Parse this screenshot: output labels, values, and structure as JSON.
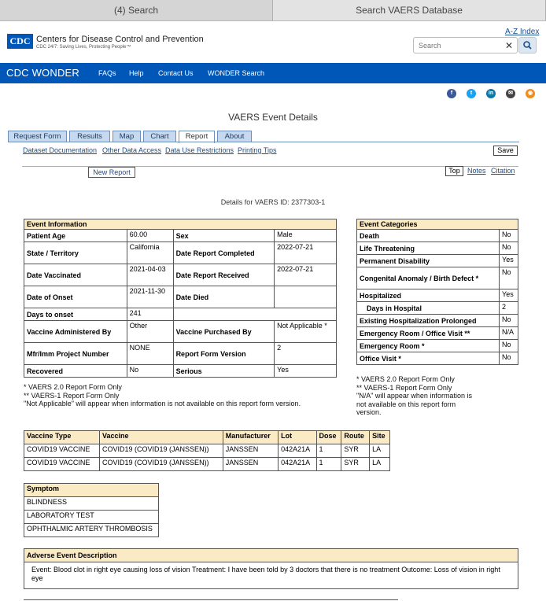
{
  "browser": {
    "tabs": [
      "(4) Search",
      "Search VAERS Database"
    ]
  },
  "header": {
    "az_index": "A-Z Index",
    "logo": "CDC",
    "org_name": "Centers for Disease Control and Prevention",
    "tagline": "CDC 24/7: Saving Lives, Protecting People™",
    "search_placeholder": "Search",
    "brand_color": "#0057b8"
  },
  "nav": {
    "title": "CDC WONDER",
    "links": [
      "FAQs",
      "Help",
      "Contact Us",
      "WONDER Search"
    ]
  },
  "social_icons": [
    "facebook-icon",
    "twitter-icon",
    "linkedin-icon",
    "email-icon",
    "syndicate-icon"
  ],
  "page_title": "VAERS Event Details",
  "tabs": [
    "Request Form",
    "Results",
    "Map",
    "Chart",
    "Report",
    "About"
  ],
  "active_tab": "Report",
  "sublinks": [
    "Dataset Documentation",
    "Other Data Access",
    "Data Use Restrictions",
    "Printing Tips"
  ],
  "save_label": "Save",
  "new_report_label": "New Report",
  "top_label": "Top",
  "notes_label": "Notes",
  "citation_label": "Citation",
  "details_id": "Details for VAERS ID: 2377303-1",
  "event_info": {
    "title": "Event Information",
    "rows": [
      {
        "l1": "Patient Age",
        "v1": "60.00",
        "l2": "Sex",
        "v2": "Male"
      },
      {
        "l1": "State / Territory",
        "v1": "California",
        "l2": "Date Report Completed",
        "v2": "2022-07-21"
      },
      {
        "l1": "Date Vaccinated",
        "v1": "2021-04-03",
        "l2": "Date Report Received",
        "v2": "2022-07-21"
      },
      {
        "l1": "Date of Onset",
        "v1": "2021-11-30",
        "l2": "Date Died",
        "v2": ""
      },
      {
        "l1": "Days to onset",
        "v1": "241"
      },
      {
        "l1": "Vaccine Administered By",
        "v1": "Other",
        "l2": "Vaccine Purchased By",
        "v2": "Not Applicable *"
      },
      {
        "l1": "Mfr/Imm Project Number",
        "v1": "NONE",
        "l2": "Report Form Version",
        "v2": "2"
      },
      {
        "l1": "Recovered",
        "v1": "No",
        "l2": "Serious",
        "v2": "Yes"
      }
    ],
    "notes": [
      "* VAERS 2.0 Report Form Only",
      "** VAERS-1 Report Form Only",
      "\"Not Applicable\" will appear when information is not available on this report form version."
    ]
  },
  "event_categories": {
    "title": "Event Categories",
    "rows": [
      {
        "label": "Death",
        "value": "No"
      },
      {
        "label": "Life Threatening",
        "value": "No"
      },
      {
        "label": "Permanent Disability",
        "value": "Yes"
      },
      {
        "label": "Congenital Anomaly / Birth Defect *",
        "value": "No"
      },
      {
        "label": "Hospitalized",
        "value": "Yes"
      },
      {
        "label": "Days in Hospital",
        "value": "2"
      },
      {
        "label": "Existing Hospitalization Prolonged",
        "value": "No"
      },
      {
        "label": "Emergency Room / Office Visit **",
        "value": "N/A"
      },
      {
        "label": "Emergency Room *",
        "value": "No"
      },
      {
        "label": "Office Visit *",
        "value": "No"
      }
    ],
    "notes": [
      "* VAERS 2.0 Report Form Only",
      "** VAERS-1 Report Form Only",
      "\"N/A\" will appear when information is not available on this report form version."
    ]
  },
  "vaccine_table": {
    "headers": [
      "Vaccine Type",
      "Vaccine",
      "Manufacturer",
      "Lot",
      "Dose",
      "Route",
      "Site"
    ],
    "rows": [
      [
        "COVID19 VACCINE",
        "COVID19 (COVID19 (JANSSEN))",
        "JANSSEN",
        "042A21A",
        "1",
        "SYR",
        "LA"
      ],
      [
        "COVID19 VACCINE",
        "COVID19 (COVID19 (JANSSEN))",
        "JANSSEN",
        "042A21A",
        "1",
        "SYR",
        "LA"
      ]
    ]
  },
  "symptom_table": {
    "header": "Symptom",
    "rows": [
      "BLINDNESS",
      "LABORATORY TEST",
      "OPHTHALMIC ARTERY THROMBOSIS"
    ]
  },
  "adverse_event": {
    "title": "Adverse Event Description",
    "text": "Event: Blood clot in right eye causing loss of vision Treatment: I have been told by 3 doctors that there is no treatment Outcome: Loss of vision in right eye"
  }
}
